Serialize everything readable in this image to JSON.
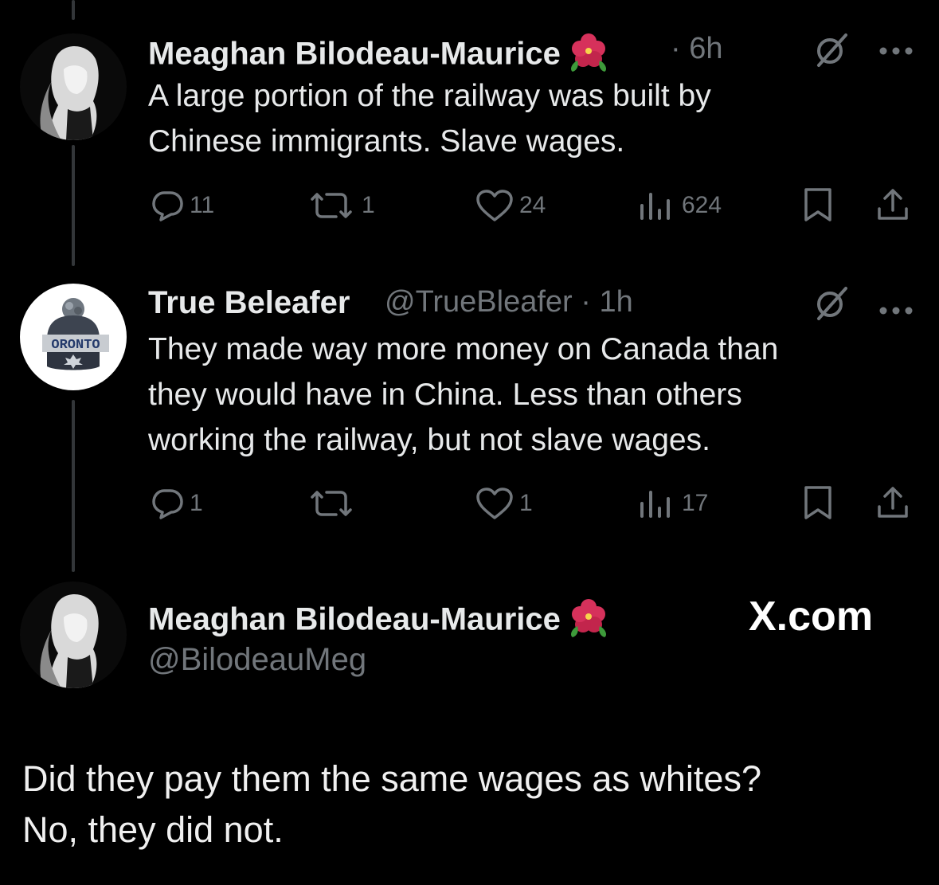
{
  "colors": {
    "background": "#000000",
    "text": "#e7e9ea",
    "muted": "#71767b",
    "thread_line": "#333639"
  },
  "tweets": [
    {
      "author": "Meaghan Bilodeau-Maurice",
      "meta": "· 6h",
      "text_lines": [
        "A large portion of the railway was built by",
        "Chinese immigrants. Slave wages."
      ],
      "stats": {
        "replies": "11",
        "reposts": "1",
        "likes": "24",
        "views": "624"
      }
    },
    {
      "author": "True Beleafer",
      "handle_meta": "@TrueBleafer · 1h",
      "avatar_text": "ORONTO",
      "text_lines": [
        "They made way more money on Canada than",
        "they would have in China. Less than others",
        "working the railway, but not slave wages."
      ],
      "stats": {
        "replies": "1",
        "reposts": "",
        "likes": "1",
        "views": "17"
      }
    }
  ],
  "quoted": {
    "author": "Meaghan Bilodeau-Maurice",
    "handle": "@BilodeauMeg",
    "text_lines": [
      "Did they pay them the same wages as whites?",
      "No, they did not."
    ]
  },
  "watermark": "X.com",
  "icons": [
    "reply-icon",
    "repost-icon",
    "like-icon",
    "views-icon",
    "bookmark-icon",
    "share-icon",
    "grok-icon",
    "more-icon",
    "hibiscus-icon"
  ]
}
